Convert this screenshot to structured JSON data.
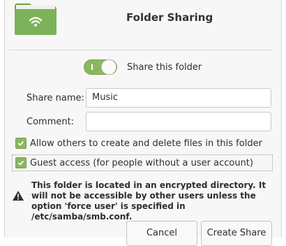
{
  "dialog": {
    "title": "Folder Sharing"
  },
  "share_toggle": {
    "label": "Share this folder",
    "on": true
  },
  "form": {
    "share_name_label": "Share name:",
    "share_name_value": "Music",
    "comment_label": "Comment:",
    "comment_value": ""
  },
  "options": {
    "allow_others_label": "Allow others to create and delete files in this folder",
    "allow_others_checked": true,
    "guest_access_label": "Guest access (for people without a user account)",
    "guest_access_checked": true
  },
  "warning": {
    "text": "This folder is located in an encrypted directory. It will not be accessible by other users unless the option 'force user' is specified in /etc/samba/smb.conf."
  },
  "buttons": {
    "cancel": "Cancel",
    "create": "Create Share"
  },
  "colors": {
    "accent": "#8ab661",
    "folder": "#7cb25a"
  },
  "icons": {
    "header": "folder-share-wifi-icon",
    "warning": "warning-icon",
    "check": "checkmark-icon"
  }
}
